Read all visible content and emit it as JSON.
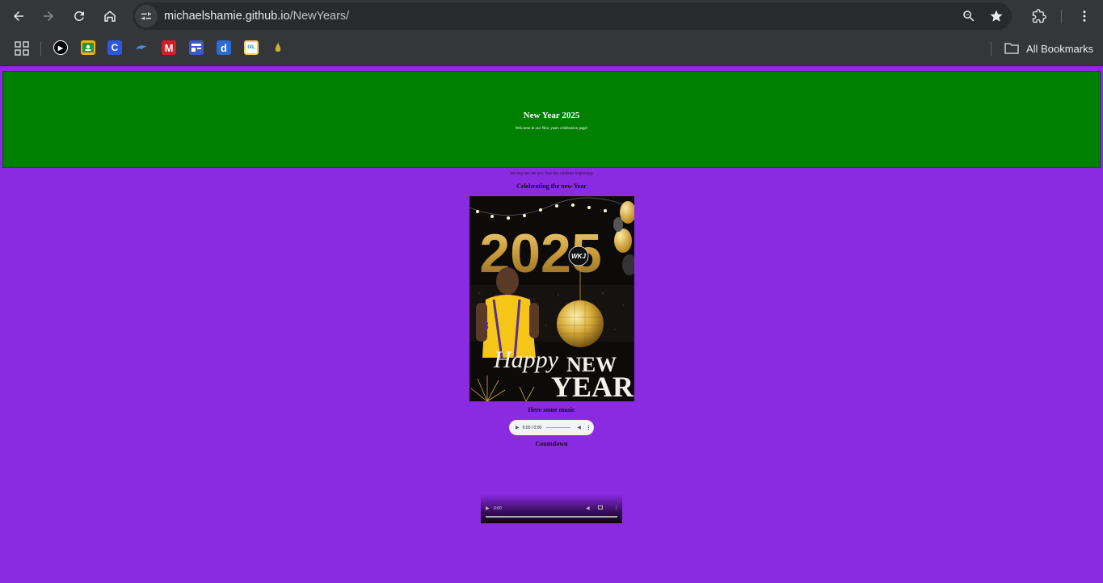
{
  "browser": {
    "url_host": "michaelshamie.github.io",
    "url_path": "/NewYears/",
    "all_bookmarks_label": "All Bookmarks",
    "bookmarks": [
      {
        "name": "apps-icon"
      },
      {
        "name": "bookmark-playback-icon",
        "glyph": "▶",
        "bg": "#000000"
      },
      {
        "name": "bookmark-classroom-icon",
        "glyph": "",
        "bg": "#f4b400"
      },
      {
        "name": "bookmark-c-icon",
        "glyph": "C",
        "bg": "#2b59d9"
      },
      {
        "name": "bookmark-dolphin-icon",
        "glyph": "",
        "bg": "#35363a"
      },
      {
        "name": "bookmark-m-icon",
        "glyph": "M",
        "bg": "#d31f26"
      },
      {
        "name": "bookmark-board-icon",
        "glyph": "",
        "bg": "#3d5ac4"
      },
      {
        "name": "bookmark-d-icon",
        "glyph": "d",
        "bg": "#2e6bd1"
      },
      {
        "name": "bookmark-ixl-icon",
        "glyph": "IXL",
        "bg": "#f7d046"
      },
      {
        "name": "bookmark-pear-icon",
        "glyph": "",
        "bg": "#35363a"
      }
    ]
  },
  "page": {
    "header_title": "New Year 2025",
    "header_subtitle": "Welcome to our New years celebration page!",
    "tagline": "We step into the new Year lets celebrate beginnings",
    "celebrating_heading": "Celebrating the new Year",
    "music_heading": "Here some music",
    "countdown_heading": "Countdown",
    "audio_time": "0:00 / 0:00",
    "video_time": "0:00",
    "poster": {
      "year": "2025",
      "badge": "WKJ",
      "line1": "Happy",
      "line2": "NEW",
      "line3": "YEAR"
    }
  },
  "colors": {
    "page_bg": "#8a2be2",
    "header_bg": "#008000",
    "chrome_bg": "#35363a"
  }
}
